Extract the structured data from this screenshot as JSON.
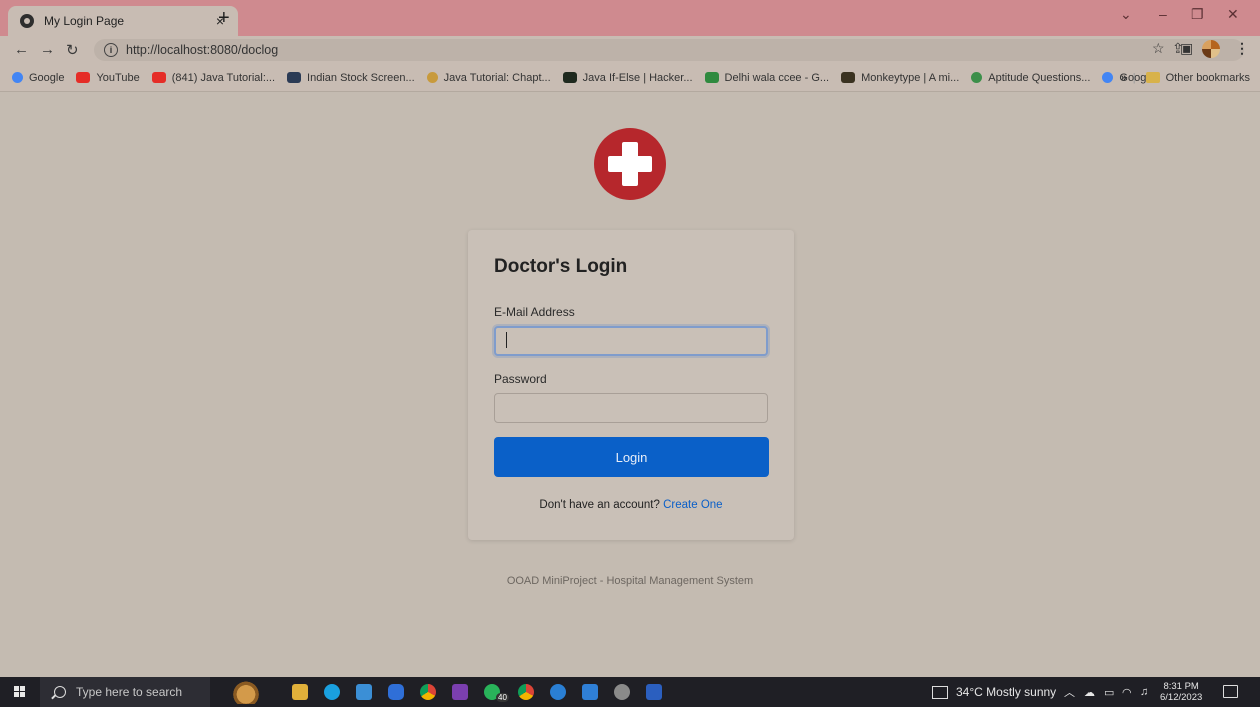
{
  "browser": {
    "tab_title": "My Login Page",
    "tab_close": "×",
    "new_tab": "+",
    "url": "http://localhost:8080/doclog",
    "bookmarks": [
      {
        "label": "Google",
        "color": "#4285f4"
      },
      {
        "label": "YouTube",
        "color": "#e52d27"
      },
      {
        "label": "(841) Java Tutorial:...",
        "color": "#e52d27"
      },
      {
        "label": "Indian Stock Screen...",
        "color": "#2b3b55"
      },
      {
        "label": "Java Tutorial: Chapt...",
        "color": "#c89a3c"
      },
      {
        "label": "Java If-Else | Hacker...",
        "color": "#1f2a1f"
      },
      {
        "label": "Delhi wala ccee - G...",
        "color": "#2f8a3f"
      },
      {
        "label": "Monkeytype | A mi...",
        "color": "#3a3220"
      },
      {
        "label": "Aptitude Questions...",
        "color": "#3c8f4a"
      },
      {
        "label": "Google",
        "color": "#4285f4"
      }
    ],
    "bookmarks_overflow": "»",
    "other_bookmarks": "Other bookmarks"
  },
  "page": {
    "heading": "Doctor's Login",
    "email_label": "E-Mail Address",
    "email_value": "",
    "password_label": "Password",
    "password_value": "",
    "login_button": "Login",
    "signup_prompt": "Don't have an account?",
    "signup_link": "Create One",
    "footer": "OOAD MiniProject - Hospital Management System",
    "logo_color": "#b6272c",
    "accent_color": "#0a60c8"
  },
  "taskbar": {
    "search_placeholder": "Type here to search",
    "weather": "34°C  Mostly sunny",
    "time": "8:31 PM",
    "date": "6/12/2023",
    "whatsapp_badge": "40"
  }
}
